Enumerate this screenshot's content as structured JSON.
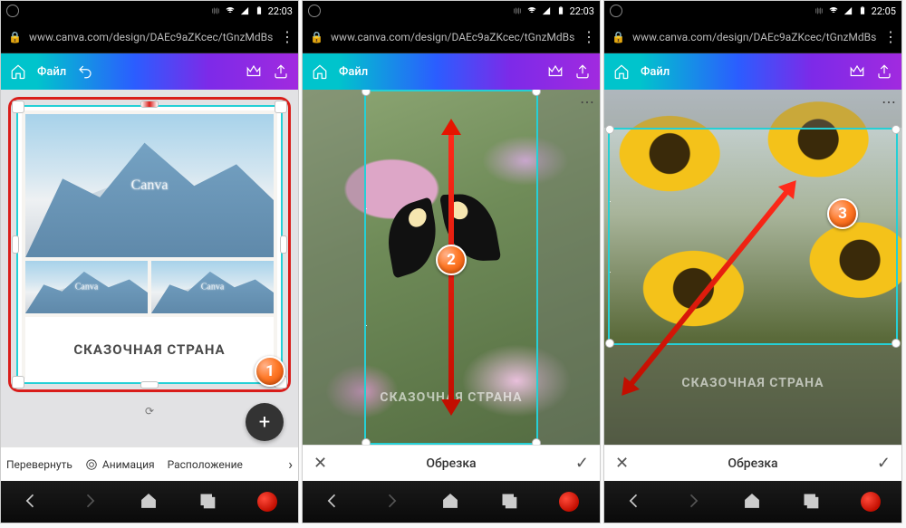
{
  "statusbar": {
    "time1": "22:03",
    "time2": "22:03",
    "time3": "22:05"
  },
  "url": "www.canva.com/design/DAEc9aZKcec/tGnzMdBs",
  "canva": {
    "file": "Файл",
    "home": "home-icon",
    "undo": "undo-icon",
    "crown": "crown-icon",
    "share": "share-icon"
  },
  "template": {
    "watermark": "Canva",
    "caption": "СКАЗОЧНАЯ СТРАНА"
  },
  "toolbar1": {
    "flip": "Перевернуть",
    "animation": "Анимация",
    "position": "Расположение"
  },
  "cropbar": {
    "label": "Обрезка"
  },
  "badges": {
    "b1": "1",
    "b2": "2",
    "b3": "3"
  }
}
